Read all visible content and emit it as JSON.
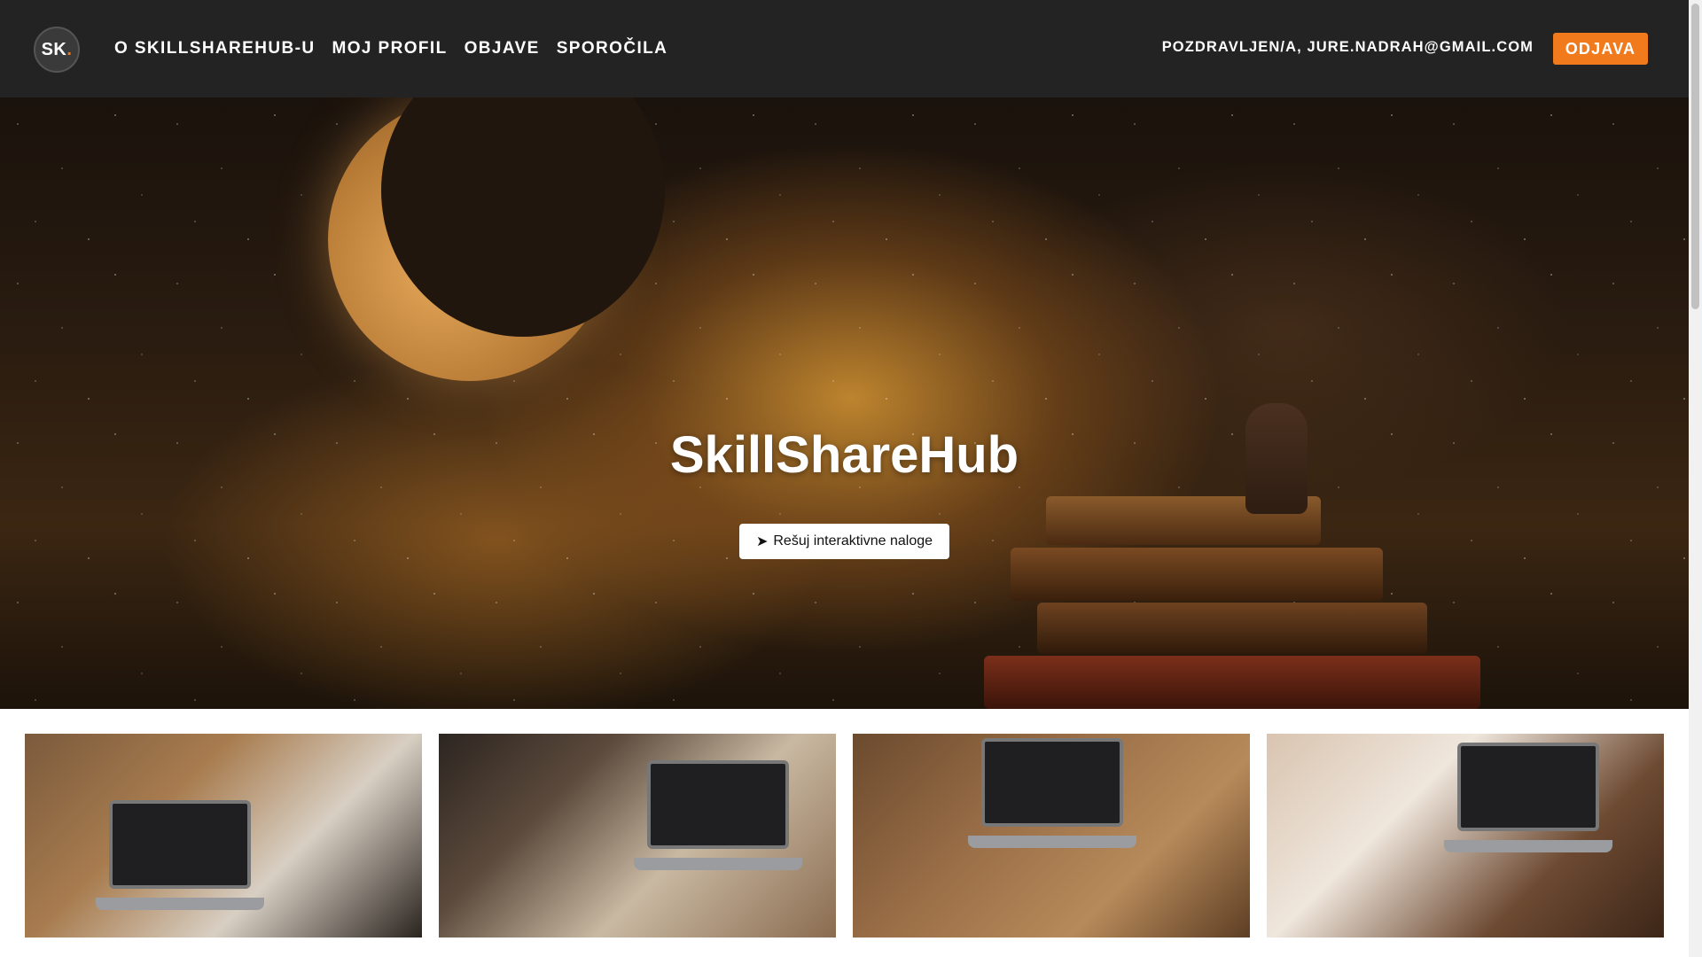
{
  "brand": {
    "logo_text": "SK",
    "logo_dot": "."
  },
  "nav": {
    "items": [
      {
        "label": "O SKILLSHAREHUB-U"
      },
      {
        "label": "MOJ PROFIL"
      },
      {
        "label": "OBJAVE"
      },
      {
        "label": "SPOROČILA"
      }
    ],
    "greeting": "POZDRAVLJEN/A, JURE.NADRAH@GMAIL.COM",
    "logout_label": "ODJAVA"
  },
  "hero": {
    "title": "SkillShareHub",
    "cta_icon": "➤",
    "cta_label": "Rešuj interaktivne naloge"
  },
  "colors": {
    "navbar_bg": "#232323",
    "accent": "#f07a1c"
  },
  "icons": [
    "logo-icon",
    "arrow-right-icon"
  ]
}
